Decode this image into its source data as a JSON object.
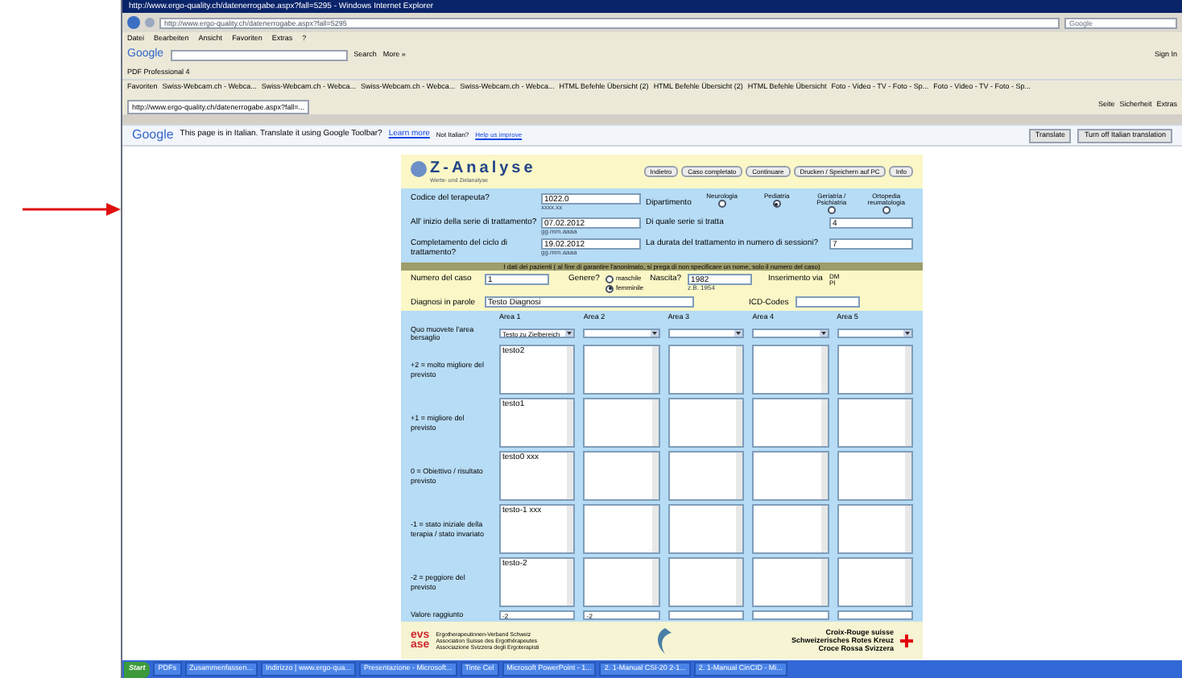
{
  "browser": {
    "title": "http://www.ergo-quality.ch/datenerrogabe.aspx?fall=5295 - Windows Internet Explorer",
    "url": "http://www.ergo-quality.ch/datenerrogabe.aspx?fall=5295",
    "search_placeholder": "Google",
    "menu": [
      "Datei",
      "Bearbeiten",
      "Ansicht",
      "Favoriten",
      "Extras",
      "?"
    ],
    "google_toolbar": {
      "logo": "Google",
      "search": "Search",
      "more": "More »",
      "sign_in": "Sign In"
    },
    "pdf_toolbar": "PDF Professional 4",
    "favorites_label": "Favoriten",
    "favorites": [
      "Swiss-Webcam.ch - Webca...",
      "Swiss-Webcam.ch - Webca...",
      "Swiss-Webcam.ch - Webca...",
      "Swiss-Webcam.ch - Webca...",
      "HTML Befehle Übersicht (2)",
      "HTML Befehle Übersicht (2)",
      "HTML Befehle Übersicht",
      "Foto - Video - TV - Foto - Sp...",
      "Foto - Video - TV - Foto - Sp..."
    ],
    "tab": "http://www.ergo-quality.ch/datenerrogabe.aspx?fall=...",
    "command_bar": [
      "Seite",
      "Sicherheit",
      "Extras"
    ]
  },
  "translate_bar": {
    "logo": "Google",
    "message": "This page is in Italian.  Translate it using Google Toolbar?",
    "learn_more": "Learn more",
    "not_italian": "Not Italian?",
    "help": "Help us improve",
    "buttons": [
      "Translate",
      "Turn off Italian translation"
    ]
  },
  "form": {
    "logo": "Z-Analyse",
    "subtitle": "Werte- und Zielanalyse",
    "nav_buttons": [
      "Indietro",
      "Caso completato",
      "Continuare",
      "Drucken / Speichern auf PC",
      "Info"
    ],
    "therapist_label": "Codice del terapeuta?",
    "therapist_value": "1022.0",
    "therapist_hint": "xxxx.xx",
    "department_label": "Dipartimento",
    "departments": [
      {
        "label": "Neurologia",
        "selected": false
      },
      {
        "label": "Pediatria",
        "selected": true
      },
      {
        "label": "Geriatria / Psichiatria",
        "selected": false
      },
      {
        "label": "Ortopedia reumatologia",
        "selected": false
      }
    ],
    "start_label": "All' inizio della serie di trattamento?",
    "start_value": "07.02.2012",
    "start_hint": "gg.mm.aaaa",
    "series_label": "Di quale serie si tratta",
    "series_value": "4",
    "end_label": "Completamento del ciclo di trattamento?",
    "end_value": "19.02.2012",
    "end_hint": "gg.mm.aaaa",
    "sessions_label": "La durata del trattamento in numero di sessioni?",
    "sessions_value": "7",
    "notice": "I dati dei pazienti ( al fine di garantire l'anonimato, si prega di non specificare un nome, solo il numero del caso)",
    "case_label": "Numero del caso",
    "case_value": "1",
    "gender_label": "Genere?",
    "genders": [
      {
        "label": "maschile",
        "selected": false
      },
      {
        "label": "femminile",
        "selected": true
      }
    ],
    "birth_label": "Nascita?",
    "birth_value": "1982",
    "birth_hint": "z.B. 1954",
    "entry_label": "Inserimento via",
    "entry_options": [
      "DM",
      "PI"
    ],
    "diagnosis_label": "Diagnosi in parole",
    "diagnosis_value": "Testo Diagnosi",
    "icd_label": "ICD-Codes",
    "areas": [
      "Area 1",
      "Area 2",
      "Area 3",
      "Area 4",
      "Area 5"
    ],
    "target_label": "Quo muovete l'area bersaglio",
    "target_value": "Testo zu Zielbereich",
    "levels": [
      {
        "label": "+2 = molto migliore del previsto",
        "area1": "testo2"
      },
      {
        "label": "+1 = migliore del previsto",
        "area1": "testo1"
      },
      {
        "label": "0 = Obiettivo / risultato previsto",
        "area1": "testo0  xxx"
      },
      {
        "label": "-1 = stato iniziale della terapia / stato invariato",
        "area1": "testo-1  xxx"
      },
      {
        "label": "-2 = peggiore del previsto",
        "area1": "testo-2"
      }
    ],
    "reached_label": "Valore raggiunto",
    "reached_values": [
      "-2",
      "-2"
    ],
    "sponsor_lines": [
      "Ergotherapeutinnen-Verband Schweiz",
      "Association Suisse des Ergothérapeutes",
      "Associazione Svizzera degli Ergoterapisti"
    ],
    "evs_logo": "evs",
    "ase_logo": "ase",
    "red_cross_lines": [
      "Croix-Rouge suisse",
      "Schweizerisches Rotes Kreuz",
      "Croce Rossa Svizzera"
    ]
  },
  "taskbar": {
    "start": "Start",
    "items": [
      "PDFs",
      "Zusammenfassen...",
      "Indirizzo | www.ergo-qua...",
      "Presentazione - Microsoft...",
      "Tinte Cel",
      "Microsoft PowerPoint - 1...",
      "2. 1-Manual CSI-20 2-1...",
      "2. 1-Manual CinCID - Mi..."
    ]
  }
}
